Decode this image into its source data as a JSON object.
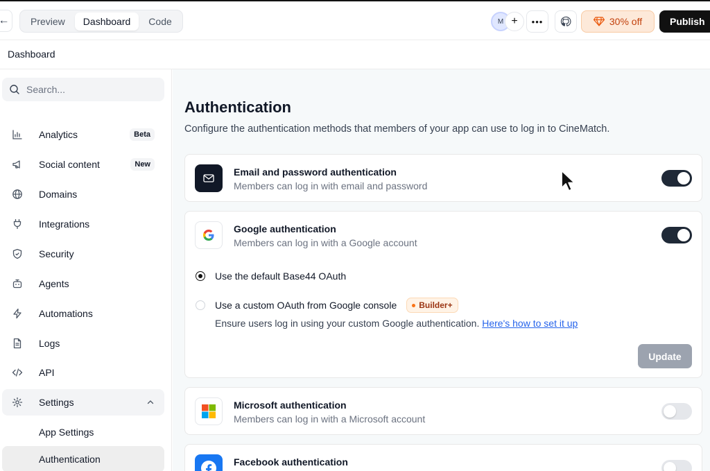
{
  "topbar": {
    "tabs": [
      {
        "label": "Preview",
        "active": false
      },
      {
        "label": "Dashboard",
        "active": true
      },
      {
        "label": "Code",
        "active": false
      }
    ],
    "avatar_initial": "M",
    "more_icon": "more-horizontal-icon",
    "discount_label": "30% off",
    "publish_label": "Publish"
  },
  "breadcrumb": "Dashboard",
  "sidebar": {
    "search_placeholder": "Search...",
    "items": [
      {
        "label": "Analytics",
        "icon": "bar-chart-icon",
        "badge": "Beta"
      },
      {
        "label": "Social content",
        "icon": "megaphone-icon",
        "badge": "New"
      },
      {
        "label": "Domains",
        "icon": "globe-icon"
      },
      {
        "label": "Integrations",
        "icon": "plug-icon"
      },
      {
        "label": "Security",
        "icon": "shield-icon"
      },
      {
        "label": "Agents",
        "icon": "bot-icon"
      },
      {
        "label": "Automations",
        "icon": "lightning-icon"
      },
      {
        "label": "Logs",
        "icon": "document-icon"
      },
      {
        "label": "API",
        "icon": "code-icon"
      },
      {
        "label": "Settings",
        "icon": "gear-icon",
        "expanded": true
      }
    ],
    "sub_items": [
      {
        "label": "App Settings",
        "active": false
      },
      {
        "label": "Authentication",
        "active": true
      }
    ]
  },
  "main": {
    "title": "Authentication",
    "description": "Configure the authentication methods that members of your app can use to log in to CineMatch.",
    "providers": [
      {
        "title": "Email and password authentication",
        "subtitle": "Members can log in with email and password",
        "enabled": true
      },
      {
        "title": "Google authentication",
        "subtitle": "Members can log in with a Google account",
        "enabled": true
      },
      {
        "title": "Microsoft authentication",
        "subtitle": "Members can log in with a Microsoft account",
        "enabled": false
      },
      {
        "title": "Facebook authentication",
        "enabled": false
      }
    ],
    "google_options": {
      "default_label": "Use the default Base44 OAuth",
      "custom_label": "Use a custom OAuth from Google console",
      "plan_badge": "Builder+",
      "help_text": "Ensure users log in using your custom Google authentication.",
      "help_link": "Here's how to set it up",
      "update_label": "Update",
      "selected": "default"
    }
  },
  "colors": {
    "toggle_on": "#1f2937",
    "discount_text": "#c2410c",
    "link": "#2563eb",
    "facebook": "#1877f2"
  }
}
